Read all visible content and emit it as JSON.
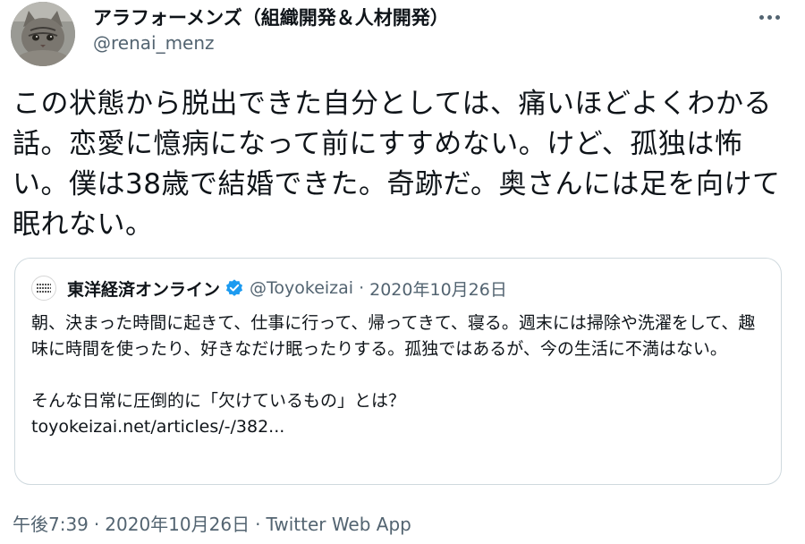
{
  "author": {
    "display_name": "アラフォーメンズ（組織開発＆人材開発）",
    "handle": "@renai_menz",
    "avatar_icon": "cat-photo-avatar"
  },
  "menu": {
    "more_icon": "more-options-icon"
  },
  "tweet": {
    "text": "この状態から脱出できた自分としては、痛いほどよくわかる話。恋愛に憶病になって前にすすめない。けど、孤独は怖い。僕は38歳で結婚できた。奇跡だ。奥さんには足を向けて眠れない。"
  },
  "quoted_tweet": {
    "name": "東洋経済オンライン",
    "verified": true,
    "handle": "@Toyokeizai",
    "separator": "·",
    "date": "2020年10月26日",
    "paragraph1": "朝、決まった時間に起きて、仕事に行って、帰ってきて、寝る。週末には掃除や洗濯をして、趣味に時間を使ったり、好きなだけ眠ったりする。孤独ではあるが、今の生活に不満はない。",
    "paragraph2": "そんな日常に圧倒的に「欠けているもの」とは？",
    "link": "toyokeizai.net/articles/-/382..."
  },
  "meta": {
    "time": "午後7:39",
    "separator": "·",
    "date": "2020年10月26日",
    "source": "Twitter Web App"
  },
  "colors": {
    "text_primary": "#0f1419",
    "text_secondary": "#536471",
    "border": "#cfd9de",
    "verified_badge": "#1d9bf0"
  }
}
